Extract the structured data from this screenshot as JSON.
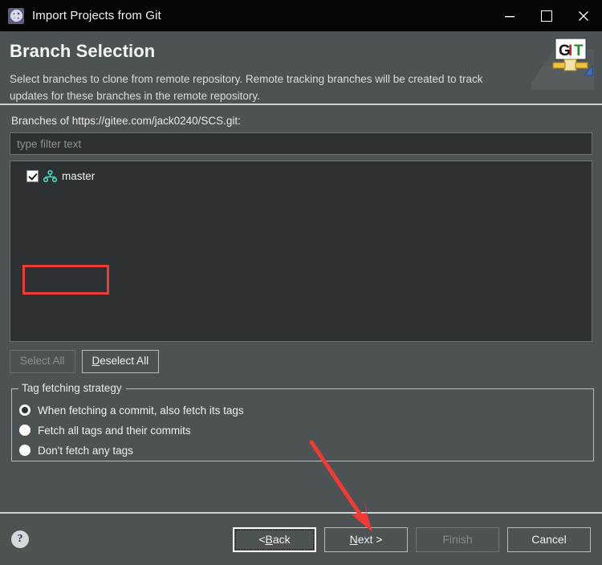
{
  "window": {
    "title": "Import Projects from Git",
    "icon": "gear-icon",
    "controls": {
      "minimize": "–",
      "maximize": "□",
      "close": "✕"
    }
  },
  "header": {
    "title": "Branch Selection",
    "description": "Select branches to clone from remote repository. Remote tracking branches will be created to track updates for these branches in the remote repository.",
    "logo_text": {
      "g": "G",
      "i": "I",
      "t": "T"
    }
  },
  "main": {
    "branches_label": "Branches of https://gitee.com/jack0240/SCS.git:",
    "filter_placeholder": "type filter text",
    "branches": [
      {
        "name": "master",
        "checked": true,
        "icon": "branch-icon"
      }
    ],
    "select_all_label": "Select All",
    "select_all_enabled": false,
    "deselect_all_label": "Deselect All",
    "deselect_all_mnemonic": "D",
    "deselect_all_rest": "eselect All",
    "deselect_all_enabled": true
  },
  "tag_group": {
    "legend": "Tag fetching strategy",
    "options": [
      {
        "label": "When fetching a commit, also fetch its tags",
        "selected": true
      },
      {
        "label": "Fetch all tags and their commits",
        "selected": false
      },
      {
        "label": "Don't fetch any tags",
        "selected": false
      }
    ]
  },
  "footer": {
    "help_label": "?",
    "buttons": [
      {
        "label": "< Back",
        "state": "focused",
        "mnemonic_before": "< ",
        "mnemonic": "B",
        "mnemonic_after": "ack"
      },
      {
        "label": "Next >",
        "state": "normal",
        "mnemonic_before": "",
        "mnemonic": "N",
        "mnemonic_after": "ext >"
      },
      {
        "label": "Finish",
        "state": "disabled",
        "mnemonic_before": "Finish",
        "mnemonic": "",
        "mnemonic_after": ""
      },
      {
        "label": "Cancel",
        "state": "normal",
        "mnemonic_before": "Cancel",
        "mnemonic": "",
        "mnemonic_after": ""
      }
    ]
  },
  "annotations": {
    "highlight_color": "#ef3b38",
    "arrow_color": "#f23a33",
    "arrow_target": "Next >"
  }
}
